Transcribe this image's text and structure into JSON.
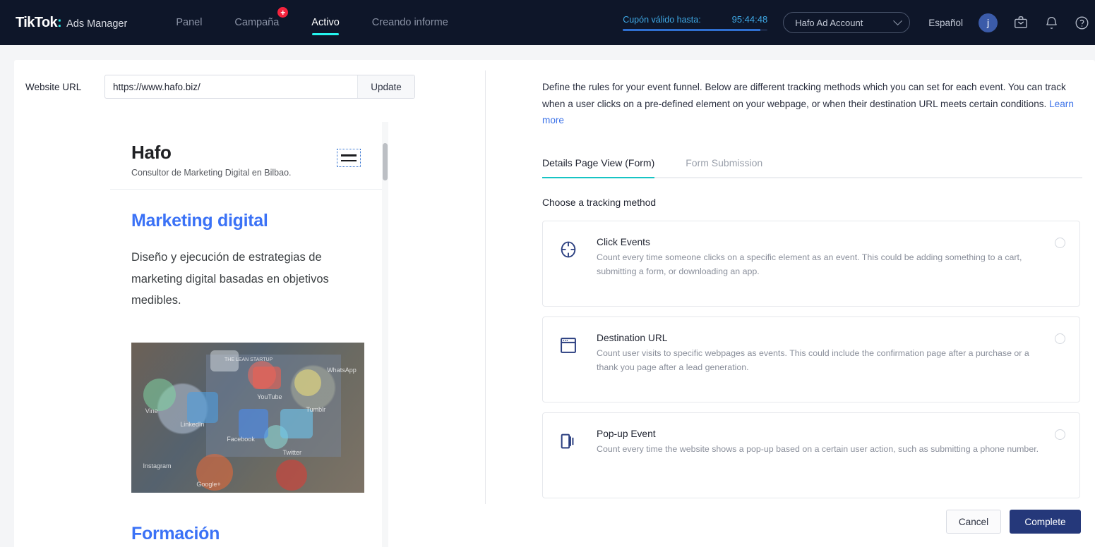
{
  "topnav": {
    "logo_text": "TikTok",
    "logo_suffix": "Ads Manager",
    "items": [
      {
        "label": "Panel",
        "active": false,
        "badge": ""
      },
      {
        "label": "Campaña",
        "active": false,
        "badge": "+"
      },
      {
        "label": "Activo",
        "active": true,
        "badge": ""
      },
      {
        "label": "Creando informe",
        "active": false,
        "badge": ""
      }
    ],
    "coupon_label": "Cupón válido hasta:",
    "coupon_time": "95:44:48",
    "account": "Hafo Ad Account",
    "language": "Español",
    "avatar_initial": "j"
  },
  "left": {
    "url_label": "Website URL",
    "url_value": "https://www.hafo.biz/",
    "url_placeholder": "https://",
    "update_label": "Update",
    "preview": {
      "site_title": "Hafo",
      "site_subtitle": "Consultor de Marketing Digital en Bilbao.",
      "heading_1": "Marketing digital",
      "paragraph_1": "Diseño y ejecución de estrategias de marketing digital basadas en objetivos medibles.",
      "heading_2": "Formación",
      "photo_labels": [
        "Vine",
        "LinkedIn",
        "Facebook",
        "Instagram",
        "Google+",
        "YouTube",
        "Tumblr",
        "Twitter",
        "WhatsApp",
        "THE LEAN STARTUP"
      ]
    }
  },
  "right": {
    "intro": "Define the rules for your event funnel. Below are different tracking methods which you can set for each event. You can track when a user clicks on a pre-defined element on your webpage, or when their destination URL meets certain conditions. ",
    "learn_more": "Learn more",
    "tabs": [
      {
        "label": "Details Page View (Form)",
        "active": true
      },
      {
        "label": "Form Submission",
        "active": false
      }
    ],
    "choose_label": "Choose a tracking method",
    "methods": [
      {
        "icon": "crosshair-icon",
        "title": "Click Events",
        "description": "Count every time someone clicks on a specific element as an event. This could be adding something to a cart, submitting a form, or downloading an app.",
        "selected": false
      },
      {
        "icon": "browser-window-icon",
        "title": "Destination URL",
        "description": "Count user visits to specific webpages as events. This could include the confirmation page after a purchase or a thank you page after a lead generation.",
        "selected": false
      },
      {
        "icon": "popup-icon",
        "title": "Pop-up Event",
        "description": "Count every time the website shows a pop-up based on a certain user action, such as submitting a phone number.",
        "selected": false
      }
    ],
    "cancel_label": "Cancel",
    "complete_label": "Complete"
  },
  "colors": {
    "nav_bg": "#0e1629",
    "tiktok_cyan": "#25f4ee",
    "tiktok_red": "#fe2c55",
    "tab_underline": "#17c4c4",
    "link_blue": "#3b72e8",
    "primary_button": "#25387a",
    "site_heading_blue": "#3b72f6",
    "badge_red": "#f5233d",
    "coupon_blue": "#3ea8e5"
  }
}
